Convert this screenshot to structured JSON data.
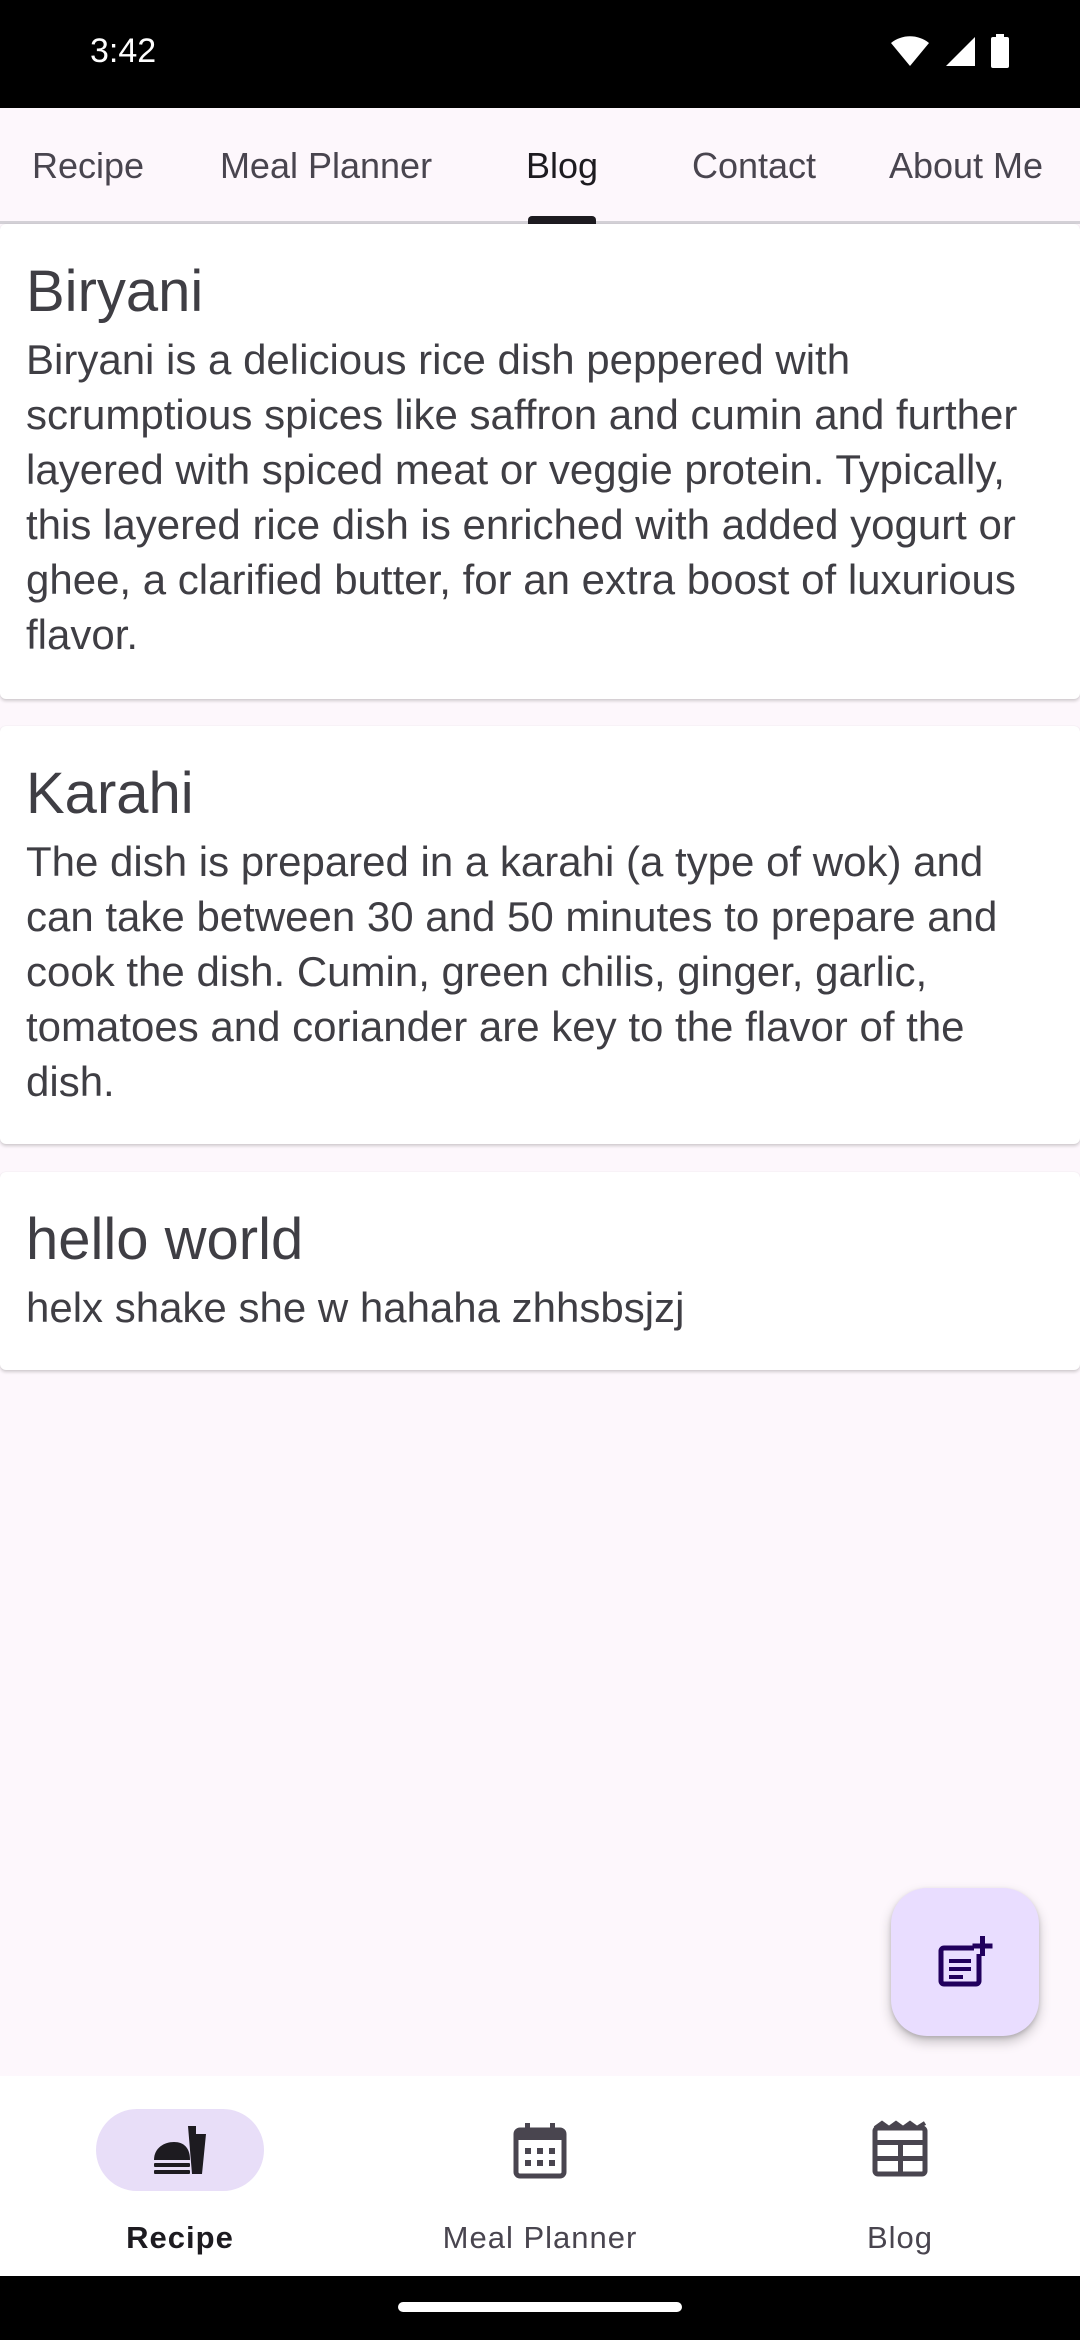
{
  "status_bar": {
    "time": "3:42"
  },
  "top_tabs": [
    {
      "label": "Recipe"
    },
    {
      "label": "Meal Planner"
    },
    {
      "label": "Blog"
    },
    {
      "label": "Contact"
    },
    {
      "label": "About Me"
    }
  ],
  "active_tab": "Blog",
  "posts": [
    {
      "title": "Biryani",
      "body": "Biryani is a delicious rice dish peppered with scrumptious spices like saffron and cumin and further layered with spiced meat or veggie protein. Typically, this layered rice dish is enriched with added yogurt or ghee, a clarified butter, for an extra boost of luxurious flavor."
    },
    {
      "title": "Karahi",
      "body": "The dish is prepared in a karahi (a type of wok) and can take between 30 and 50 minutes to prepare and cook the dish. Cumin, green chilis, ginger, garlic, tomatoes and coriander are key to the flavor of the dish."
    },
    {
      "title": "hello world",
      "body": "helx shake she w hahaha zhhsbsjzj"
    }
  ],
  "fab": {
    "icon": "add-post-icon"
  },
  "bottom_nav": [
    {
      "label": "Recipe",
      "icon": "fastfood-icon"
    },
    {
      "label": "Meal Planner",
      "icon": "calendar-icon"
    },
    {
      "label": "Blog",
      "icon": "newspaper-icon"
    }
  ],
  "colors": {
    "background": "#fdf7fc",
    "fab": "#e9ddff",
    "nav_pill": "#e8def8",
    "text": "#3f3e44"
  }
}
